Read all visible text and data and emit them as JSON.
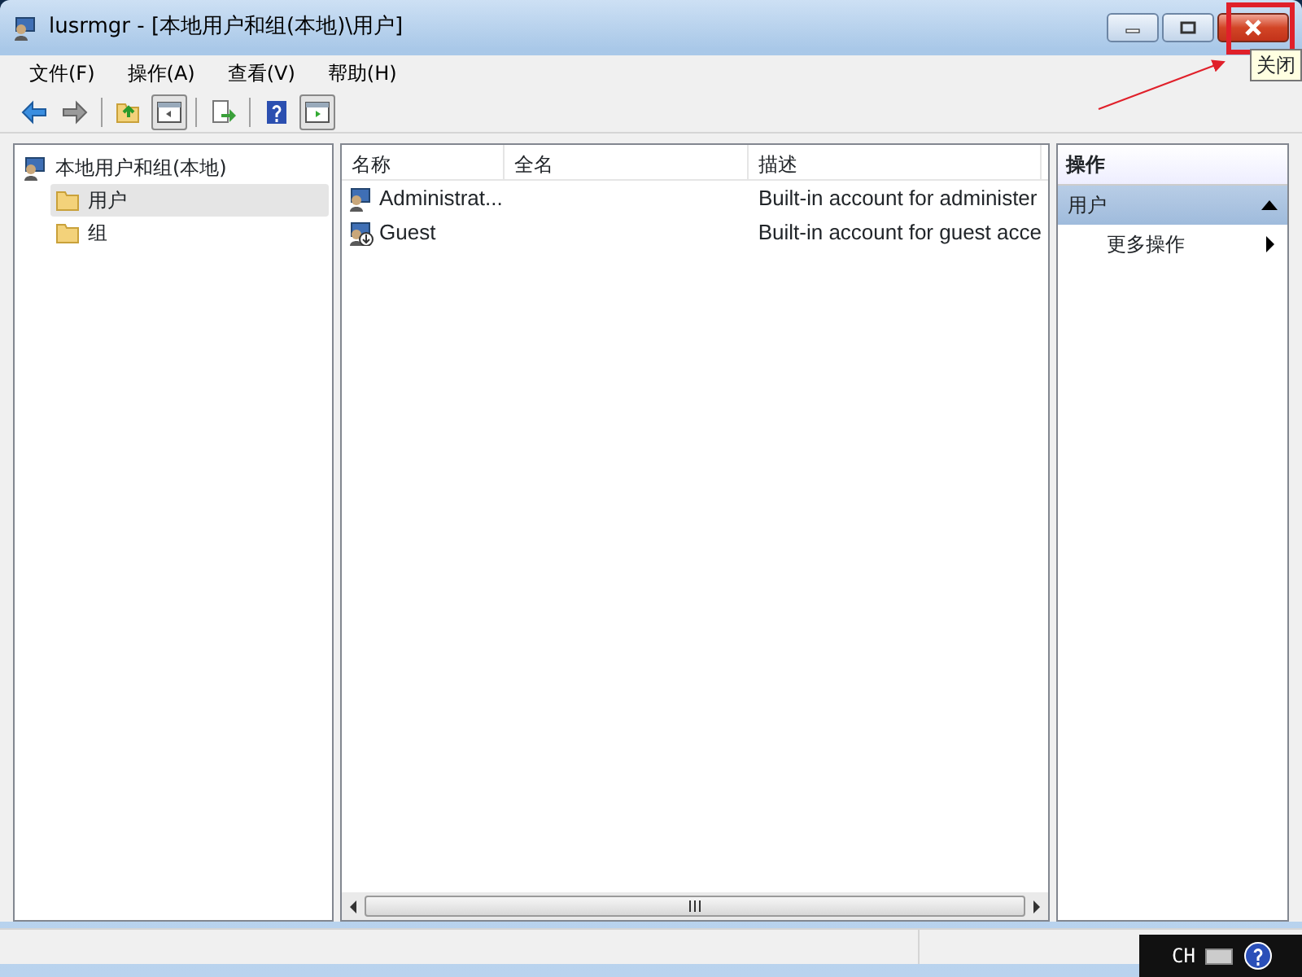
{
  "window": {
    "title": "lusrmgr - [本地用户和组(本地)\\用户]"
  },
  "tooltip": "关闭",
  "menu": [
    "文件(F)",
    "操作(A)",
    "查看(V)",
    "帮助(H)"
  ],
  "tree": [
    {
      "label": "本地用户和组(本地)",
      "selected": false,
      "children": [
        {
          "label": "用户",
          "selected": true
        },
        {
          "label": "组",
          "selected": false
        }
      ]
    }
  ],
  "table": {
    "columns": [
      "名称",
      "全名",
      "描述"
    ],
    "rows": [
      {
        "kind": "admin",
        "name": "Administrat...",
        "description": "Built-in account for administer"
      },
      {
        "kind": "guest",
        "name": "Guest",
        "description": "Built-in account for guest acce"
      }
    ]
  },
  "actions": {
    "title": "操作",
    "section": {
      "label": "用户",
      "expanded": true
    },
    "items": [
      "更多操作"
    ]
  },
  "language_bar": {
    "label": "CH"
  }
}
